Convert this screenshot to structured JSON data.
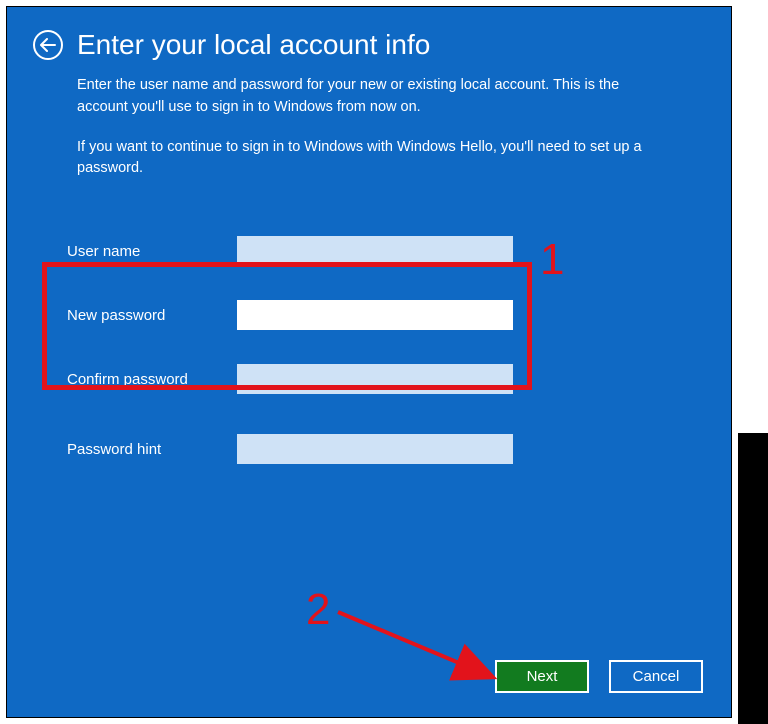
{
  "header": {
    "title": "Enter your local account info"
  },
  "description": {
    "p1": "Enter the user name and password for your new or existing local account. This is the account you'll use to sign in to Windows from now on.",
    "p2": "If you want to continue to sign in to Windows with Windows Hello, you'll need to set up a password."
  },
  "form": {
    "username_label": "User name",
    "username_value": "",
    "new_password_label": "New password",
    "new_password_value": "",
    "confirm_password_label": "Confirm password",
    "confirm_password_value": "",
    "hint_label": "Password hint",
    "hint_value": ""
  },
  "buttons": {
    "next": "Next",
    "cancel": "Cancel"
  },
  "annotations": {
    "ann1": "1",
    "ann2": "2"
  },
  "colors": {
    "background": "#0f69c4",
    "annotation": "#e2131b",
    "next_button": "#127b1f"
  }
}
